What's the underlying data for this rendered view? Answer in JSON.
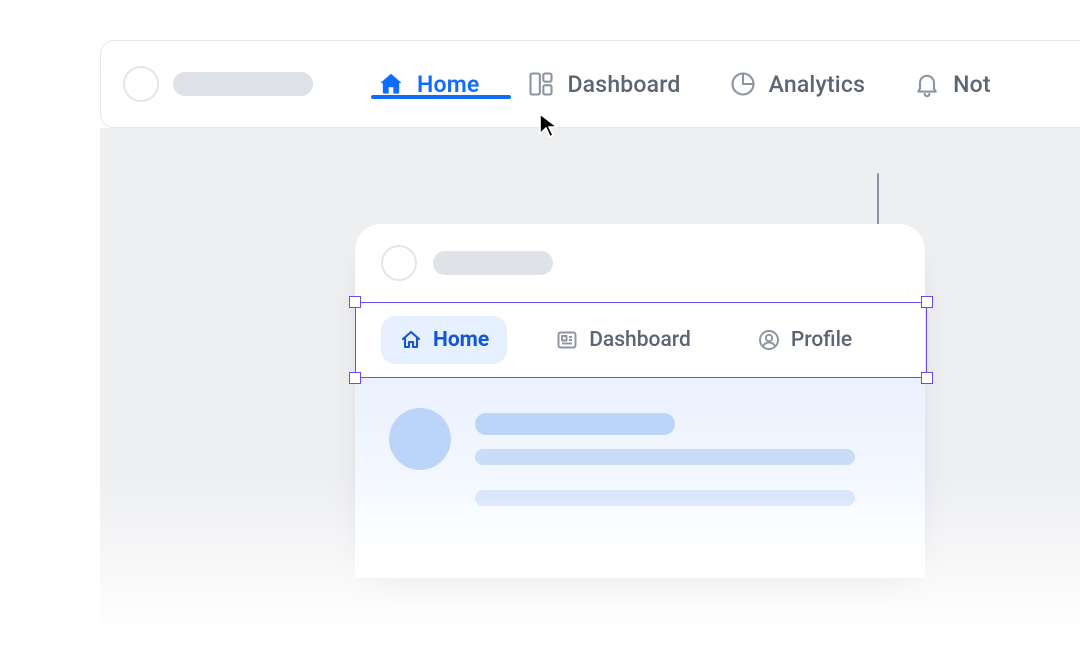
{
  "topnav": {
    "items": [
      {
        "label": "Home",
        "icon": "home-icon",
        "active": true
      },
      {
        "label": "Dashboard",
        "icon": "dashboard-icon",
        "active": false
      },
      {
        "label": "Analytics",
        "icon": "analytics-icon",
        "active": false
      },
      {
        "label": "Not",
        "icon": "bell-icon",
        "active": false
      }
    ]
  },
  "frame": {
    "tabs": [
      {
        "label": "Home",
        "icon": "home-icon",
        "selected": true
      },
      {
        "label": "Dashboard",
        "icon": "news-icon",
        "selected": false
      },
      {
        "label": "Profile",
        "icon": "profile-icon",
        "selected": false
      }
    ]
  },
  "colors": {
    "accent": "#0F6EFF",
    "selection": "#6C4CF1",
    "text_muted": "#5A6673"
  }
}
